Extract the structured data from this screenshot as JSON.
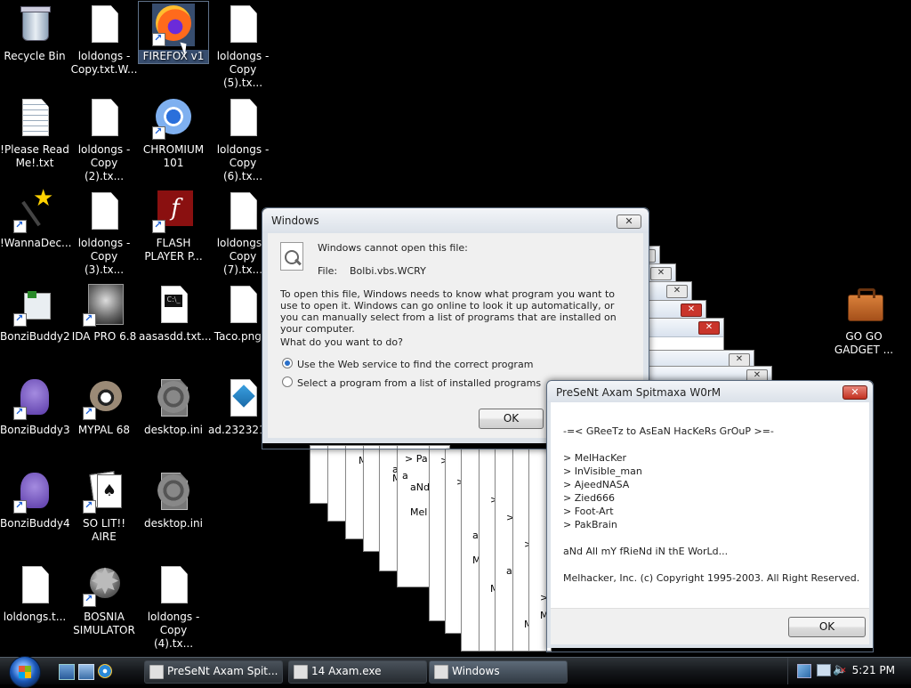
{
  "desktop": {
    "icons": [
      {
        "label": "Recycle Bin"
      },
      {
        "label": "loldongs - Copy.txt.W..."
      },
      {
        "label": "FIREFOX v1"
      },
      {
        "label": "loldongs - Copy (5).tx..."
      },
      {
        "label": "!Please Read Me!.txt"
      },
      {
        "label": "loldongs - Copy (2).tx..."
      },
      {
        "label": "CHROMIUM 101"
      },
      {
        "label": "loldongs - Copy (6).tx..."
      },
      {
        "label": "!WannaDec..."
      },
      {
        "label": "loldongs - Copy (3).tx..."
      },
      {
        "label": "FLASH PLAYER P..."
      },
      {
        "label": "loldongs - Copy (7).tx..."
      },
      {
        "label": "BonziBuddy2"
      },
      {
        "label": "IDA PRO 6.8"
      },
      {
        "label": "aasasdd.txt..."
      },
      {
        "label": "Taco.png..."
      },
      {
        "label": "BonziBuddy3"
      },
      {
        "label": "MYPAL 68"
      },
      {
        "label": "desktop.ini"
      },
      {
        "label": "ad.2323213..."
      },
      {
        "label": "BonziBuddy4"
      },
      {
        "label": "SO LIT!! AIRE"
      },
      {
        "label": "desktop.ini"
      },
      {
        "label": "loldongs.t..."
      },
      {
        "label": "BOSNIA SIMULATOR"
      },
      {
        "label": "loldongs - Copy (4).tx..."
      },
      {
        "label": "GO GO GADGET ..."
      }
    ]
  },
  "background_boxes": {
    "fragments": [
      " > Pa",
      "aNd",
      "Mel",
      "a",
      "M",
      "a",
      "M",
      "M",
      ">",
      ">",
      ">",
      ">",
      ">",
      ">",
      "a",
      "a",
      "M",
      "M",
      "M"
    ]
  },
  "open_with_dialog": {
    "title": "Windows",
    "message": "Windows cannot open this file:",
    "file_label": "File:",
    "file_name": "Bolbi.vbs.WCRY",
    "explanation": "To open this file, Windows needs to know what program you want to use to open it.  Windows can go online to look it up automatically, or you can manually select from a list of programs that are installed on your computer.",
    "question": "What do you want to do?",
    "options": [
      {
        "label": "Use the Web service to find the correct program",
        "selected": true
      },
      {
        "label": "Select a program from a list of installed programs",
        "selected": false
      }
    ],
    "ok_label": "OK",
    "close_glyph": "✕"
  },
  "worm_dialog": {
    "title": "PreSeNt Axam Spitmaxa W0rM",
    "greetz": "-=< GReeTz to AsEaN HacKeRs GrOuP >=-",
    "names": [
      "> MelHacKer",
      "> InVisible_man",
      "> AjeedNASA",
      "> Zied666",
      "> Foot-Art",
      "> PakBrain"
    ],
    "friends": "aNd All mY fRieNd iN thE WorLd...",
    "copyright": "Melhacker, Inc. (c) Copyright 1995-2003. All Right Reserved.",
    "ok_label": "OK",
    "close_glyph": "✕"
  },
  "taskbar": {
    "buttons": [
      {
        "label": "PreSeNt Axam Spit..."
      },
      {
        "label": "14 Axam.exe"
      },
      {
        "label": "Windows"
      }
    ],
    "clock": "5:21 PM"
  }
}
